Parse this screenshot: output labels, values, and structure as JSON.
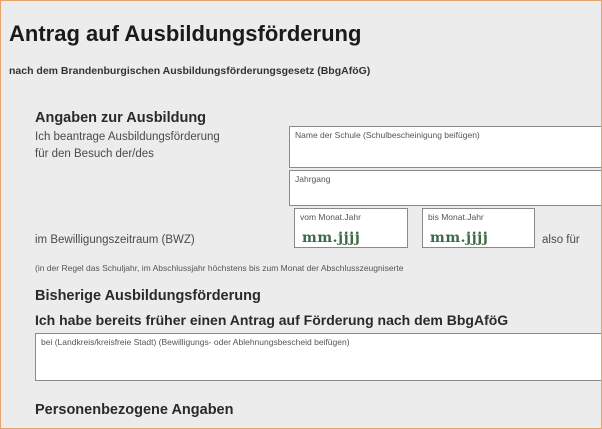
{
  "header": {
    "title": "Antrag auf Ausbildungsförderung",
    "subtitle": "nach dem Brandenburgischen Ausbildungsförderungsgesetz (BbgAföG)"
  },
  "ausbildung": {
    "heading": "Angaben zur Ausbildung",
    "text_line1": "Ich beantrage Ausbildungsförderung",
    "text_line2": "für den Besuch der/des",
    "school_field_label": "Name der Schule (Schulbescheinigung beifügen)",
    "jahrgang_field_label": "Jahrgang",
    "bwz_label": "im Bewilligungszeitraum (BWZ)",
    "from_label": "vom Monat.Jahr",
    "from_value": "mm.jjjj",
    "to_label": "bis Monat.Jahr",
    "to_value": "mm.jjjj",
    "also_fuer": "also für",
    "note": "(in der Regel das Schuljahr, im Abschlussjahr höchstens bis zum Monat der Abschlusszeugniserte"
  },
  "bisherige": {
    "heading": "Bisherige Ausbildungsförderung",
    "question": "Ich habe bereits früher einen Antrag auf Förderung nach dem BbgAföG",
    "field_label": "bei (Landkreis/kreisfreie Stadt) (Bewilligungs- oder Ablehnungsbescheid beifügen)"
  },
  "personen": {
    "heading": "Personenbezogene Angaben"
  }
}
